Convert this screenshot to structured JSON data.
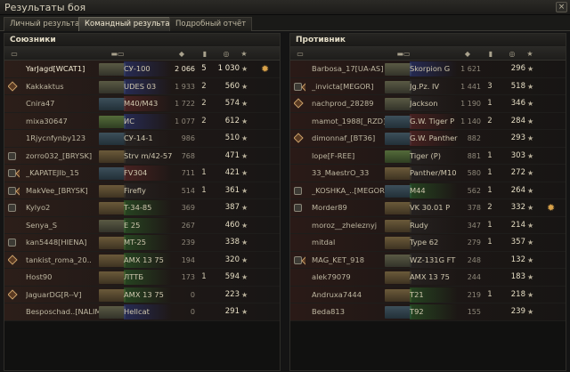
{
  "window": {
    "title": "Результаты боя",
    "close_label": "×"
  },
  "tabs": [
    {
      "label": "Личный результат"
    },
    {
      "label": "Командный результат"
    },
    {
      "label": "Подробный отчёт"
    }
  ],
  "allies": {
    "title": "Союзники",
    "rows": [
      {
        "name": "YarJagd[WCAT1]",
        "vehicle": "СУ-100",
        "dmg": "2 066",
        "kills": "5",
        "xp": "1 030",
        "badge": "",
        "type": "td",
        "tint": "#2a3a8a",
        "highlight": true,
        "medal": true
      },
      {
        "name": "Kakkaktus",
        "vehicle": "UDES 03",
        "dmg": "1 933",
        "kills": "2",
        "xp": "560",
        "badge": "d",
        "type": "td",
        "tint": "#2a3a8a"
      },
      {
        "name": "Cnira47",
        "vehicle": "M40/M43",
        "dmg": "1 722",
        "kills": "2",
        "xp": "574",
        "badge": "",
        "type": "spg",
        "tint": "#6a2a2a"
      },
      {
        "name": "mixa30647",
        "vehicle": "ИС",
        "dmg": "1 077",
        "kills": "2",
        "xp": "612",
        "badge": "",
        "type": "heavy",
        "tint": "#2a3a8a"
      },
      {
        "name": "1Rjycnfynby123",
        "vehicle": "СУ-14-1",
        "dmg": "986",
        "kills": "",
        "xp": "510",
        "badge": "",
        "type": "spg",
        "tint": "#2a2a2a"
      },
      {
        "name": "zorro032_[BRYSK]",
        "vehicle": "Strv m/42-57",
        "dmg": "768",
        "kills": "",
        "xp": "471",
        "badge": "b",
        "type": "med",
        "tint": "#2a2a2a"
      },
      {
        "name": "_KAPATEJIb_15",
        "vehicle": "FV304",
        "dmg": "711",
        "kills": "1",
        "xp": "421",
        "badge": "bd",
        "type": "spg",
        "tint": "#6a2a2a"
      },
      {
        "name": "MakVee_[BRYSK]",
        "vehicle": "Firefly",
        "dmg": "514",
        "kills": "1",
        "xp": "361",
        "badge": "bd",
        "type": "med",
        "tint": "#2a2a2a"
      },
      {
        "name": "Kylyo2",
        "vehicle": "T-34-85",
        "dmg": "369",
        "kills": "",
        "xp": "387",
        "badge": "b",
        "type": "med",
        "tint": "#2a6a2a"
      },
      {
        "name": "Senya_S",
        "vehicle": "E 25",
        "dmg": "267",
        "kills": "",
        "xp": "460",
        "badge": "",
        "type": "td",
        "tint": "#2a6a2a"
      },
      {
        "name": "kan5448[HIENA]",
        "vehicle": "MT-25",
        "dmg": "239",
        "kills": "",
        "xp": "338",
        "badge": "b",
        "type": "med",
        "tint": "#2a6a2a"
      },
      {
        "name": "tankist_roma_20..",
        "vehicle": "AMX 13 75",
        "dmg": "194",
        "kills": "",
        "xp": "320",
        "badge": "d",
        "type": "med",
        "tint": "#2a6a2a"
      },
      {
        "name": "Host90",
        "vehicle": "ЛТТБ",
        "dmg": "173",
        "kills": "1",
        "xp": "594",
        "badge": "",
        "type": "med",
        "tint": "#2a6a2a"
      },
      {
        "name": "JaguarDG[R--V]",
        "vehicle": "AMX 13 75",
        "dmg": "0",
        "kills": "",
        "xp": "223",
        "badge": "d",
        "type": "med",
        "tint": "#2a6a2a"
      },
      {
        "name": "Besposchad..[NALIM]",
        "vehicle": "Hellcat",
        "dmg": "0",
        "kills": "",
        "xp": "291",
        "badge": "",
        "type": "td",
        "tint": "#2a3a8a"
      }
    ]
  },
  "enemies": {
    "title": "Противник",
    "rows": [
      {
        "name": "Barbosa_17[UA-AS]",
        "vehicle": "Skorpion G",
        "dmg": "1 621",
        "kills": "",
        "xp": "296",
        "badge": "",
        "type": "td",
        "tint": "#2a3a8a"
      },
      {
        "name": "_invicta[MEGOR]",
        "vehicle": "Jg.Pz. IV",
        "dmg": "1 441",
        "kills": "3",
        "xp": "518",
        "badge": "bd",
        "type": "td",
        "tint": "#2a2a2a"
      },
      {
        "name": "nachprod_28289",
        "vehicle": "Jackson",
        "dmg": "1 190",
        "kills": "1",
        "xp": "346",
        "badge": "d",
        "type": "td",
        "tint": "#2a2a2a"
      },
      {
        "name": "mamot_1988[_RZD]",
        "vehicle": "G.W. Tiger P",
        "dmg": "1 140",
        "kills": "2",
        "xp": "284",
        "badge": "",
        "type": "spg",
        "tint": "#6a2a2a"
      },
      {
        "name": "dimonnaf_[BT36]",
        "vehicle": "G.W. Panther",
        "dmg": "882",
        "kills": "",
        "xp": "293",
        "badge": "d",
        "type": "spg",
        "tint": "#6a2a2a"
      },
      {
        "name": "lope[F-REE]",
        "vehicle": "Tiger (P)",
        "dmg": "881",
        "kills": "1",
        "xp": "303",
        "badge": "",
        "type": "heavy",
        "tint": "#2a2a2a"
      },
      {
        "name": "33_MaestrO_33",
        "vehicle": "Panther/M10",
        "dmg": "580",
        "kills": "1",
        "xp": "272",
        "badge": "",
        "type": "med",
        "tint": "#2a2a2a"
      },
      {
        "name": "_KOSHKA_..[MEGOR]",
        "vehicle": "M44",
        "dmg": "562",
        "kills": "1",
        "xp": "264",
        "badge": "b",
        "type": "spg",
        "tint": "#2a6a2a"
      },
      {
        "name": "Morder89",
        "vehicle": "VK 30.01 P",
        "dmg": "378",
        "kills": "2",
        "xp": "332",
        "badge": "b",
        "type": "med",
        "tint": "#2a2a2a",
        "medal": true
      },
      {
        "name": "moroz__zheleznyj",
        "vehicle": "Rudy",
        "dmg": "347",
        "kills": "1",
        "xp": "214",
        "badge": "",
        "type": "med",
        "tint": "#2a2a2a"
      },
      {
        "name": "mitdal",
        "vehicle": "Type 62",
        "dmg": "279",
        "kills": "1",
        "xp": "357",
        "badge": "",
        "type": "med",
        "tint": "#2a2a2a"
      },
      {
        "name": "MAG_KET_918",
        "vehicle": "WZ-131G FT",
        "dmg": "248",
        "kills": "",
        "xp": "132",
        "badge": "bd",
        "type": "td",
        "tint": "#2a2a2a"
      },
      {
        "name": "alek79079",
        "vehicle": "AMX 13 75",
        "dmg": "244",
        "kills": "",
        "xp": "183",
        "badge": "",
        "type": "med",
        "tint": "#2a2a2a"
      },
      {
        "name": "Andruxa7444",
        "vehicle": "T21",
        "dmg": "219",
        "kills": "1",
        "xp": "218",
        "badge": "",
        "type": "med",
        "tint": "#2a6a2a"
      },
      {
        "name": "Beda813",
        "vehicle": "T92",
        "dmg": "155",
        "kills": "",
        "xp": "239",
        "badge": "",
        "type": "spg",
        "tint": "#2a6a2a"
      }
    ]
  },
  "icons": {
    "star": "★",
    "medal": "✹",
    "column_icons": [
      "badge-icon",
      "tank-icon",
      "damage-icon",
      "kills-icon",
      "xp-icon",
      "medal-icon"
    ]
  }
}
